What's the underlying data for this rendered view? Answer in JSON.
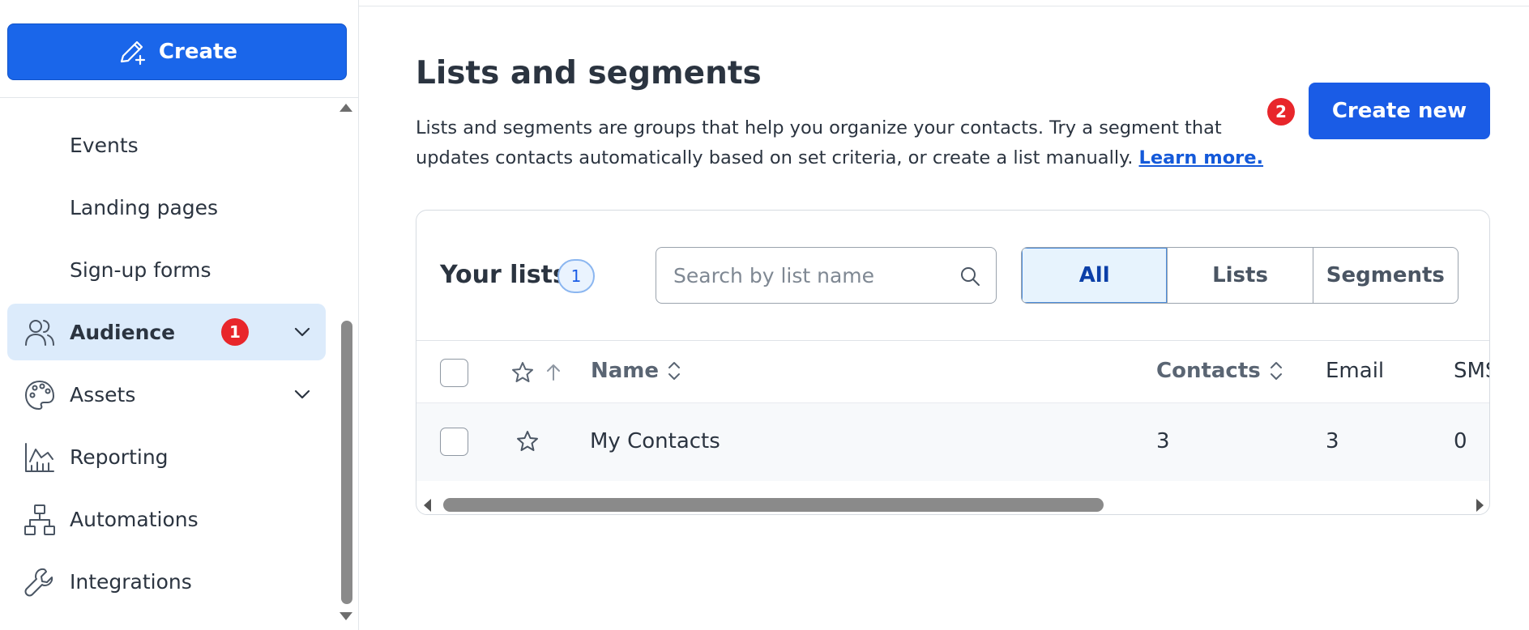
{
  "sidebar": {
    "create_label": "Create",
    "items": [
      {
        "label": "Events"
      },
      {
        "label": "Landing pages"
      },
      {
        "label": "Sign-up forms"
      },
      {
        "label": "Audience",
        "badge": "1"
      },
      {
        "label": "Assets"
      },
      {
        "label": "Reporting"
      },
      {
        "label": "Automations"
      },
      {
        "label": "Integrations"
      }
    ]
  },
  "header": {
    "title": "Lists and segments",
    "description": "Lists and segments are groups that help you organize your contacts. Try a segment that updates contacts automatically based on set criteria, or create a list manually.",
    "learn_more": "Learn more.",
    "step_badge": "2",
    "create_new_label": "Create new"
  },
  "lists": {
    "title": "Your lists",
    "count": "1",
    "search_placeholder": "Search by list name",
    "filters": [
      "All",
      "Lists",
      "Segments"
    ],
    "active_filter": "All",
    "columns": {
      "name": "Name",
      "contacts": "Contacts",
      "email": "Email",
      "sms": "SMS"
    },
    "rows": [
      {
        "name": "My Contacts",
        "contacts": "3",
        "email": "3",
        "sms": "0"
      }
    ]
  },
  "colors": {
    "primary": "#1a66ea",
    "active_nav_bg": "#dcebfb",
    "badge_red": "#e8262b",
    "link": "#1459d9"
  },
  "icons": {
    "create": "pencil-plus-icon",
    "audience": "users-icon",
    "assets": "palette-icon",
    "reporting": "chart-icon",
    "automations": "flow-icon",
    "integrations": "wrench-icon",
    "search": "search-icon",
    "favorite": "star-icon",
    "sort": "sort-icon"
  }
}
